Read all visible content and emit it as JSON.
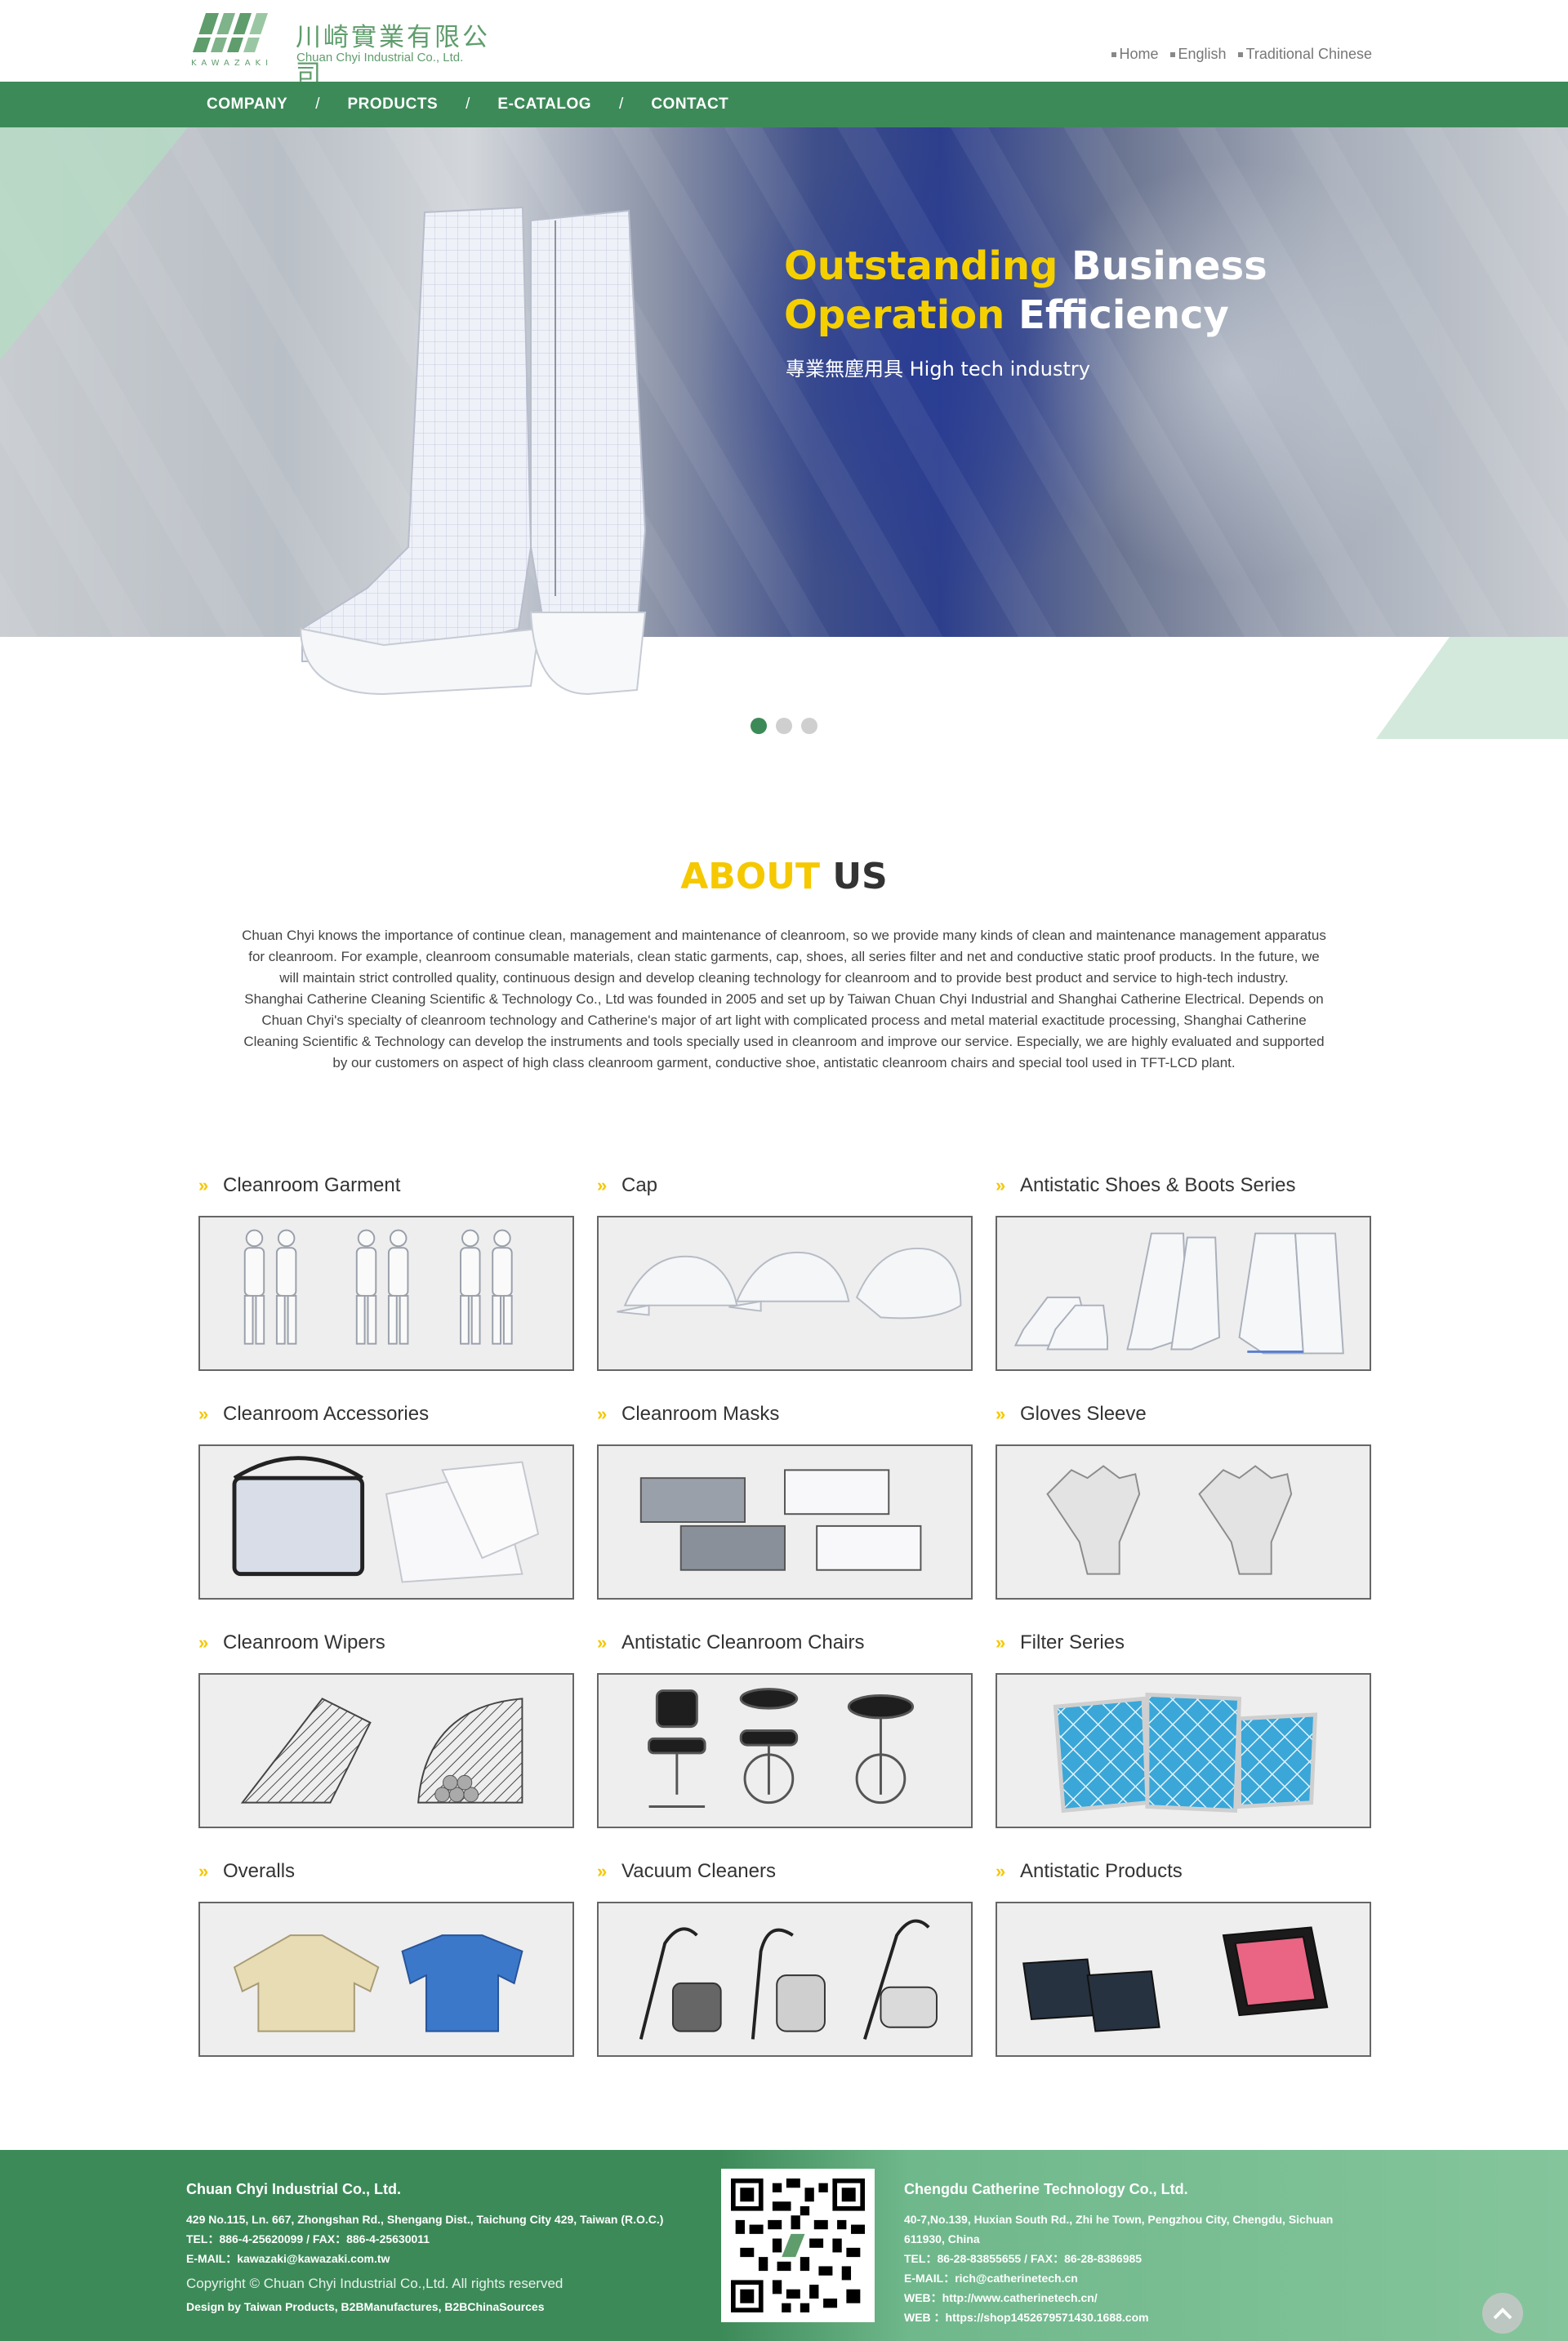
{
  "header": {
    "logo_cn": "川崎實業有限公司",
    "logo_en": "Chuan Chyi Industrial Co., Ltd.",
    "logo_mark_text": "KAWAZAKI",
    "lang_links": [
      "Home",
      "English",
      "Traditional Chinese"
    ]
  },
  "nav": {
    "items": [
      "COMPANY",
      "PRODUCTS",
      "E-CATALOG",
      "CONTACT"
    ],
    "separator": "/"
  },
  "hero": {
    "line1_yellow": "Outstanding",
    "line1_white": " Business",
    "line2_yellow": "Operation",
    "line2_white": " Efficiency",
    "subtitle": "專業無塵用具 High tech industry",
    "slides": 3,
    "active_slide": 1
  },
  "about": {
    "title_yellow": "ABOUT",
    "title_dark": " US",
    "lines": [
      "Chuan Chyi knows the importance of continue clean, management and maintenance of cleanroom, so we provide many kinds of clean and maintenance management apparatus",
      "for cleanroom. For example, cleanroom consumable materials, clean static garments, cap, shoes, all series filter and net and conductive static proof products. In the future, we",
      "will maintain strict controlled quality, continuous design and develop cleaning technology for cleanroom and to provide best product and service to high-tech industry.",
      "Shanghai Catherine Cleaning Scientific & Technology Co., Ltd was founded in 2005 and set up by Taiwan Chuan Chyi Industrial and Shanghai Catherine Electrical. Depends on",
      "Chuan Chyi's specialty of cleanroom technology and Catherine's major of art light with complicated process and metal material exactitude processing, Shanghai Catherine",
      "Cleaning Scientific & Technology can develop the instruments and tools specially used in cleanroom and improve our service. Especially, we are highly evaluated and supported",
      "by our customers on aspect of high class cleanroom garment, conductive shoe, antistatic cleanroom chairs and special tool used in TFT-LCD plant."
    ]
  },
  "products": [
    {
      "title": "Cleanroom Garment",
      "icon": "garment"
    },
    {
      "title": "Cap",
      "icon": "cap"
    },
    {
      "title": "Antistatic Shoes & Boots Series",
      "icon": "boots"
    },
    {
      "title": "Cleanroom Accessories",
      "icon": "bag"
    },
    {
      "title": "Cleanroom Masks",
      "icon": "masks"
    },
    {
      "title": "Gloves Sleeve",
      "icon": "gloves"
    },
    {
      "title": "Cleanroom Wipers",
      "icon": "wipers"
    },
    {
      "title": "Antistatic Cleanroom Chairs",
      "icon": "chairs"
    },
    {
      "title": "Filter Series",
      "icon": "filters"
    },
    {
      "title": "Overalls",
      "icon": "overalls"
    },
    {
      "title": "Vacuum Cleaners",
      "icon": "vacuum"
    },
    {
      "title": "Antistatic Products",
      "icon": "trays"
    }
  ],
  "footer": {
    "left": {
      "company": "Chuan Chyi Industrial Co., Ltd.",
      "address": "429 No.115, Ln. 667, Zhongshan Rd., Shengang Dist., Taichung City 429, Taiwan (R.O.C.)",
      "tel": "TEL：886-4-25620099 / FAX：886-4-25630011",
      "email": "E-MAIL：kawazaki@kawazaki.com.tw",
      "copyright": "Copyright © Chuan Chyi Industrial Co.,Ltd. All rights reserved",
      "design": "Design by Taiwan Products, B2BManufactures, B2BChinaSources"
    },
    "right": {
      "company": "Chengdu Catherine Technology Co., Ltd.",
      "address1": "40-7,No.139, Huxian South Rd., Zhi he Town, Pengzhou City, Chengdu, Sichuan",
      "address2": "611930, China",
      "tel": "TEL：86-28-83855655    / FAX：86-28-8386985",
      "email": "E-MAIL：rich@catherinetech.cn",
      "web1": "WEB：http://www.catherinetech.cn/",
      "web2": "WEB ：https://shop1452679571430.1688.com"
    }
  },
  "colors": {
    "brand_green": "#3d8a59",
    "accent_yellow": "#f5c800",
    "footer_light_green": "#85c59c"
  }
}
